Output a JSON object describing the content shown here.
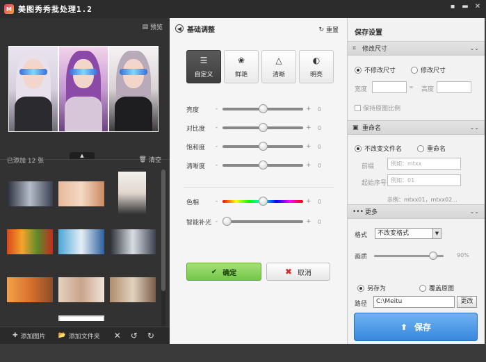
{
  "window": {
    "title": "美图秀秀批处理1.2",
    "icon_text": "M"
  },
  "left": {
    "preview_label": "预览",
    "added_count": "已添加 12 张",
    "clear_label": "清空",
    "add_image_label": "添加图片",
    "add_folder_label": "添加文件夹"
  },
  "middle": {
    "title": "基础调整",
    "reset_label": "重置",
    "modes": [
      {
        "label": "自定义",
        "icon": "sliders-icon"
      },
      {
        "label": "鲜艳",
        "icon": "flower-icon"
      },
      {
        "label": "清晰",
        "icon": "triangle-icon"
      },
      {
        "label": "明亮",
        "icon": "contrast-icon"
      }
    ],
    "sliders": [
      {
        "label": "亮度",
        "value": "0",
        "level": 0.5
      },
      {
        "label": "对比度",
        "value": "0",
        "level": 0.5
      },
      {
        "label": "饱和度",
        "value": "0",
        "level": 0.5
      },
      {
        "label": "清晰度",
        "value": "0",
        "level": 0.5
      },
      {
        "label": "色相",
        "value": "0",
        "level": 0.5
      },
      {
        "label": "智能补光",
        "value": "0",
        "level": 0.0
      }
    ],
    "minus": "-",
    "plus": "+",
    "ok_label": "确定",
    "cancel_label": "取消"
  },
  "right": {
    "title": "保存设置",
    "resize_section": "修改尺寸",
    "no_resize": "不修改尺寸",
    "resize": "修改尺寸",
    "width_label": "宽度",
    "height_label": "高度",
    "keep_ratio": "保持原图比例",
    "rename_section": "重命名",
    "no_rename": "不改变文件名",
    "rename": "重命名",
    "prefix_label": "前缀",
    "prefix_placeholder": "例如：mtxx",
    "start_label": "起始序号",
    "start_placeholder": "例如：01",
    "example": "示例：mtxx01，mtxx02...",
    "more_section": "更多",
    "format_label": "格式",
    "format_value": "不改变格式",
    "quality_label": "画质",
    "quality_value": "90%",
    "quality_level": 0.9,
    "save_as": "另存为",
    "overwrite": "覆盖原图",
    "path_label": "路径",
    "path_value": "C:\\Meitu",
    "change_label": "更改",
    "save_label": "保存"
  }
}
